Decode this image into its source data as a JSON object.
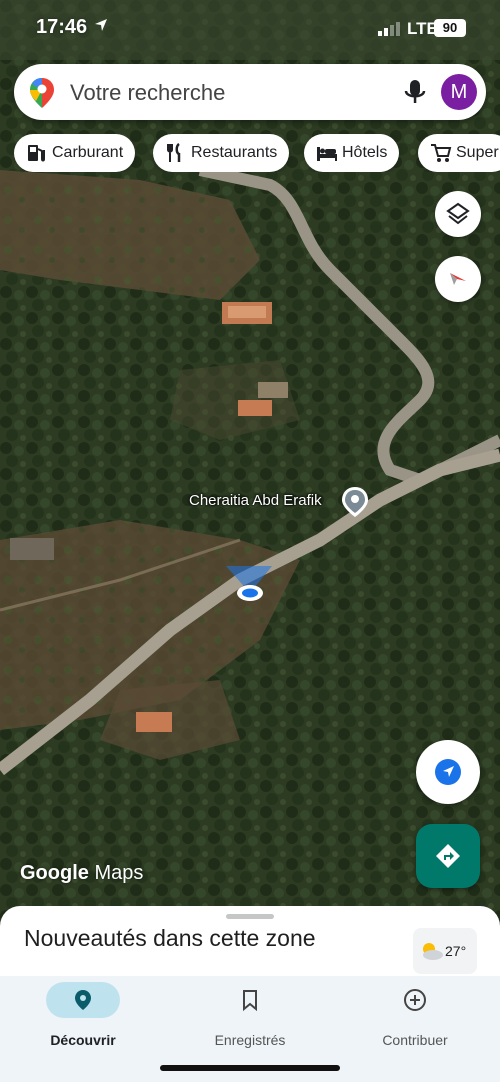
{
  "status_bar": {
    "time": "17:46",
    "network": "LTE",
    "battery": "90"
  },
  "search": {
    "placeholder": "Votre recherche",
    "avatar_letter": "M"
  },
  "chips": [
    {
      "label": "Carburant",
      "icon": "fuel-icon"
    },
    {
      "label": "Restaurants",
      "icon": "restaurant-icon"
    },
    {
      "label": "Hôtels",
      "icon": "bed-icon"
    },
    {
      "label": "Super",
      "icon": "cart-icon"
    }
  ],
  "map": {
    "place_label": "Cheraitia Abd Erafik",
    "watermark_google": "Google",
    "watermark_maps": "Maps"
  },
  "sheet": {
    "title": "Nouveautés dans cette zone",
    "temperature": "27°"
  },
  "nav": [
    {
      "label": "Découvrir",
      "icon": "explore-pin-icon",
      "active": true
    },
    {
      "label": "Enregistrés",
      "icon": "bookmark-icon",
      "active": false
    },
    {
      "label": "Contribuer",
      "icon": "add-circle-icon",
      "active": false
    }
  ],
  "colors": {
    "accent": "#00796b",
    "avatar": "#7b1fa2",
    "nav_active": "#bfe3ee",
    "location_dot": "#1a73e8"
  }
}
